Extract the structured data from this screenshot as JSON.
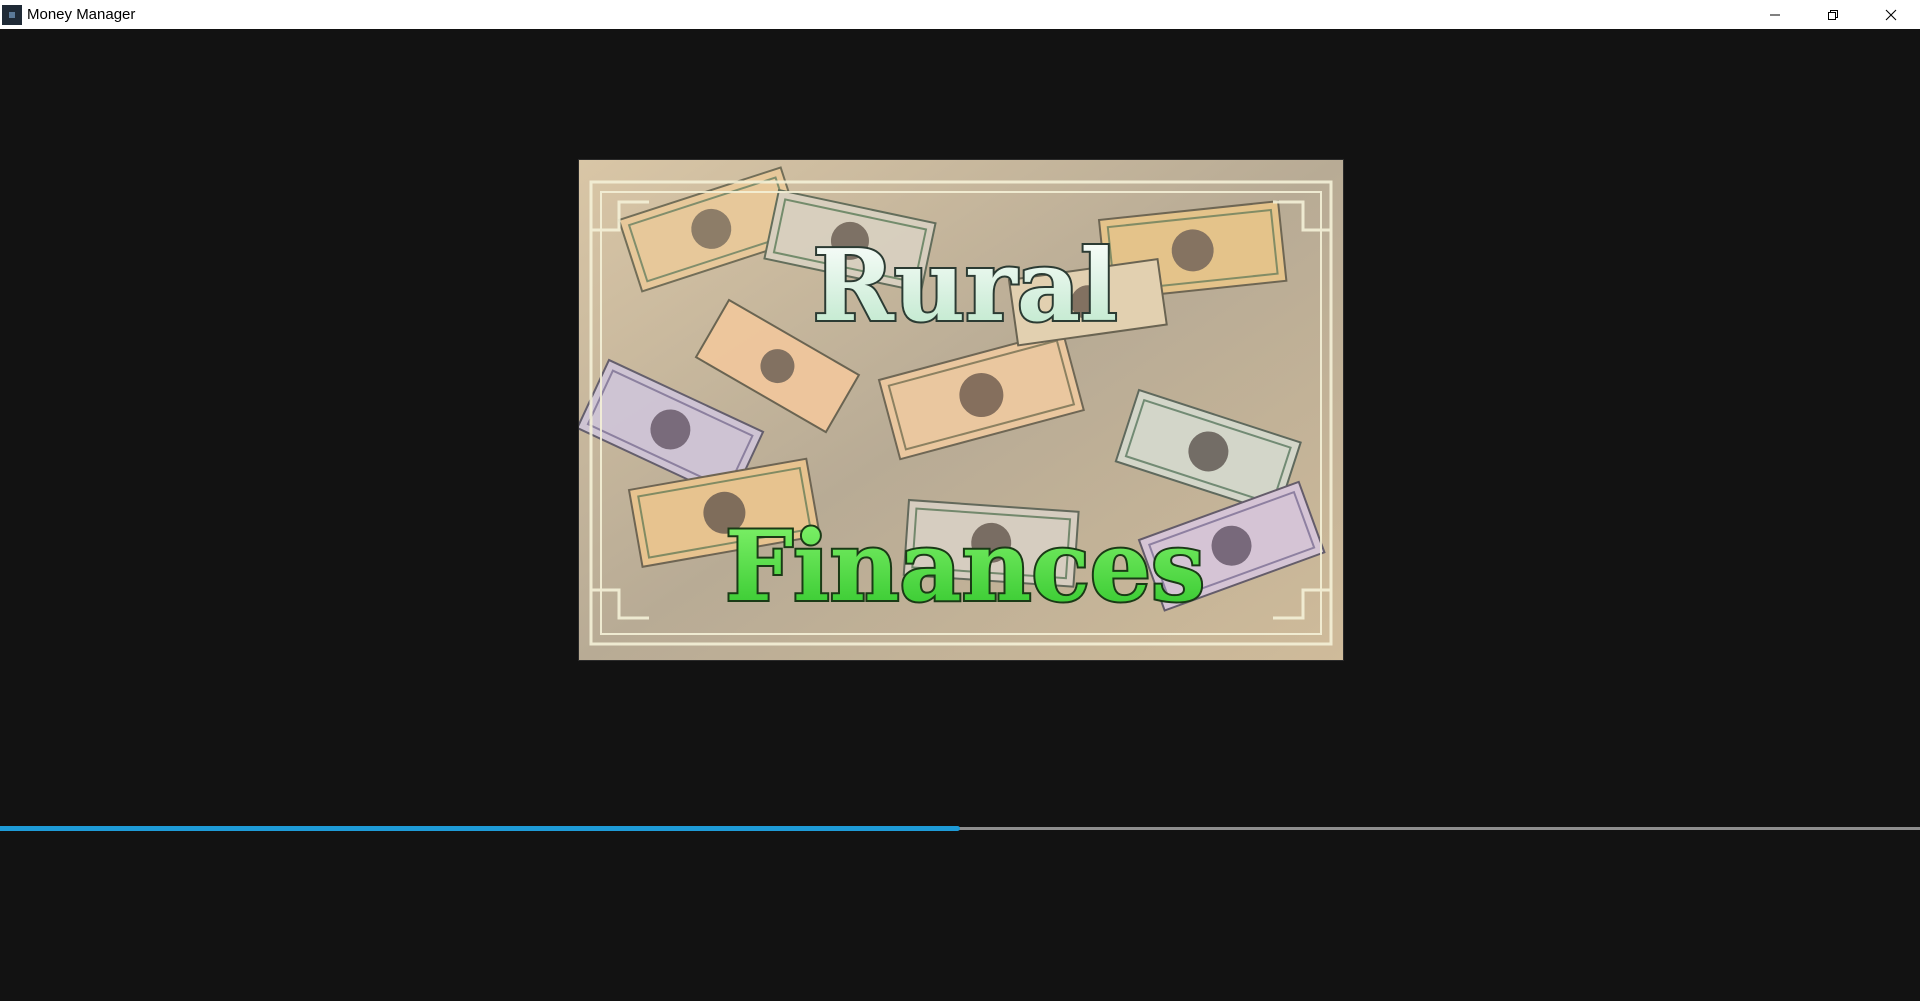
{
  "window": {
    "title": "Money Manager",
    "controls": {
      "minimize_icon": "minimize-icon",
      "maximize_icon": "restore-icon",
      "close_icon": "close-icon"
    }
  },
  "splash": {
    "title_line1": "Rural",
    "title_line2": "Finances",
    "background": "money-bills-collage"
  },
  "loading": {
    "progress": 0.5,
    "track_color": "#8e8e8e",
    "fill_color": "#1e9bd7"
  },
  "colors": {
    "background": "#121212",
    "title_line1_fill": "#d7f2e0",
    "title_line2_fill": "#4fe83f"
  }
}
